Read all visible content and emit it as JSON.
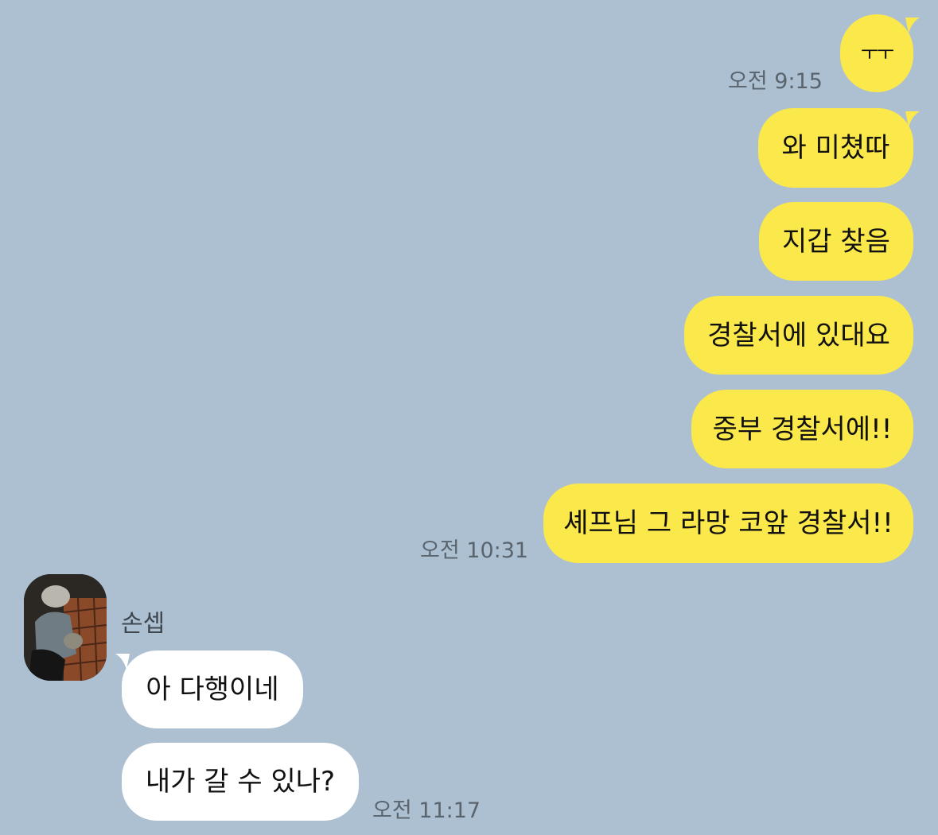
{
  "colors": {
    "background": "#adc0d1",
    "outgoing_bubble": "#fbe84a",
    "incoming_bubble": "#ffffff",
    "timestamp": "#5a646e"
  },
  "outgoing": {
    "msg1": "ㅜㅜ",
    "time1": "오전 9:15",
    "msg2": "와 미쳤따",
    "msg3": "지갑 찾음",
    "msg4": "경찰서에 있대요",
    "msg5": "중부 경찰서에!!",
    "msg6": "셰프님 그 라망 코앞 경찰서!!",
    "time2": "오전 10:31"
  },
  "incoming": {
    "sender_name": "손셉",
    "avatar_icon": "profile-photo",
    "msg1": "아 다행이네",
    "msg2": "내가 갈 수 있나?",
    "time": "오전 11:17"
  }
}
